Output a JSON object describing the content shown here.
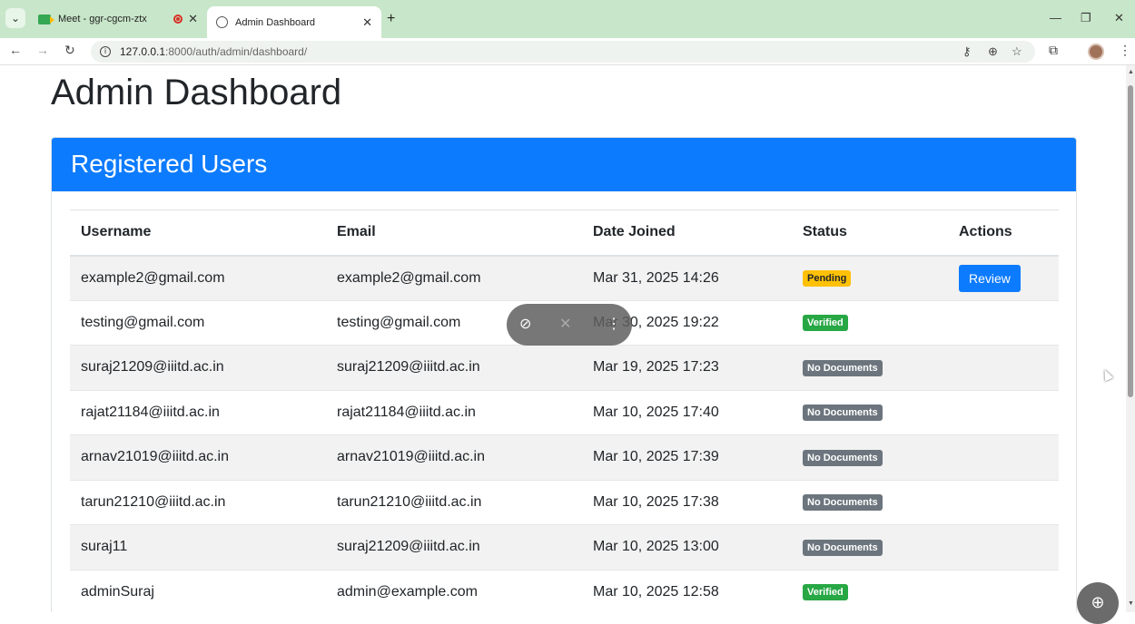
{
  "browser": {
    "tabs": [
      {
        "title": "Meet - ggr-cgcm-ztx",
        "icon": "google-meet-icon",
        "recording": true
      },
      {
        "title": "Admin Dashboard",
        "icon": "globe-icon",
        "active": true
      }
    ],
    "url_host": "127.0.0.1",
    "url_path": ":8000/auth/admin/dashboard/"
  },
  "page": {
    "title": "Admin Dashboard",
    "card_title": "Registered Users"
  },
  "table": {
    "headers": [
      "Username",
      "Email",
      "Date Joined",
      "Status",
      "Actions"
    ],
    "rows": [
      {
        "username": "example2@gmail.com",
        "email": "example2@gmail.com",
        "date": "Mar 31, 2025 14:26",
        "status": "Pending",
        "action": "Review"
      },
      {
        "username": "testing@gmail.com",
        "email": "testing@gmail.com",
        "date": "Mar 30, 2025 19:22",
        "status": "Verified",
        "action": ""
      },
      {
        "username": "suraj21209@iiitd.ac.in",
        "email": "suraj21209@iiitd.ac.in",
        "date": "Mar 19, 2025 17:23",
        "status": "No Documents",
        "action": ""
      },
      {
        "username": "rajat21184@iiitd.ac.in",
        "email": "rajat21184@iiitd.ac.in",
        "date": "Mar 10, 2025 17:40",
        "status": "No Documents",
        "action": ""
      },
      {
        "username": "arnav21019@iiitd.ac.in",
        "email": "arnav21019@iiitd.ac.in",
        "date": "Mar 10, 2025 17:39",
        "status": "No Documents",
        "action": ""
      },
      {
        "username": "tarun21210@iiitd.ac.in",
        "email": "tarun21210@iiitd.ac.in",
        "date": "Mar 10, 2025 17:38",
        "status": "No Documents",
        "action": ""
      },
      {
        "username": "suraj11",
        "email": "suraj21209@iiitd.ac.in",
        "date": "Mar 10, 2025 13:00",
        "status": "No Documents",
        "action": ""
      },
      {
        "username": "adminSuraj",
        "email": "admin@example.com",
        "date": "Mar 10, 2025 12:58",
        "status": "Verified",
        "action": ""
      }
    ]
  },
  "colors": {
    "primary": "#0d7bfd",
    "pending": "#ffc107",
    "verified": "#28a745",
    "no_documents": "#6c757d",
    "tabbar": "#c8e6c9"
  }
}
